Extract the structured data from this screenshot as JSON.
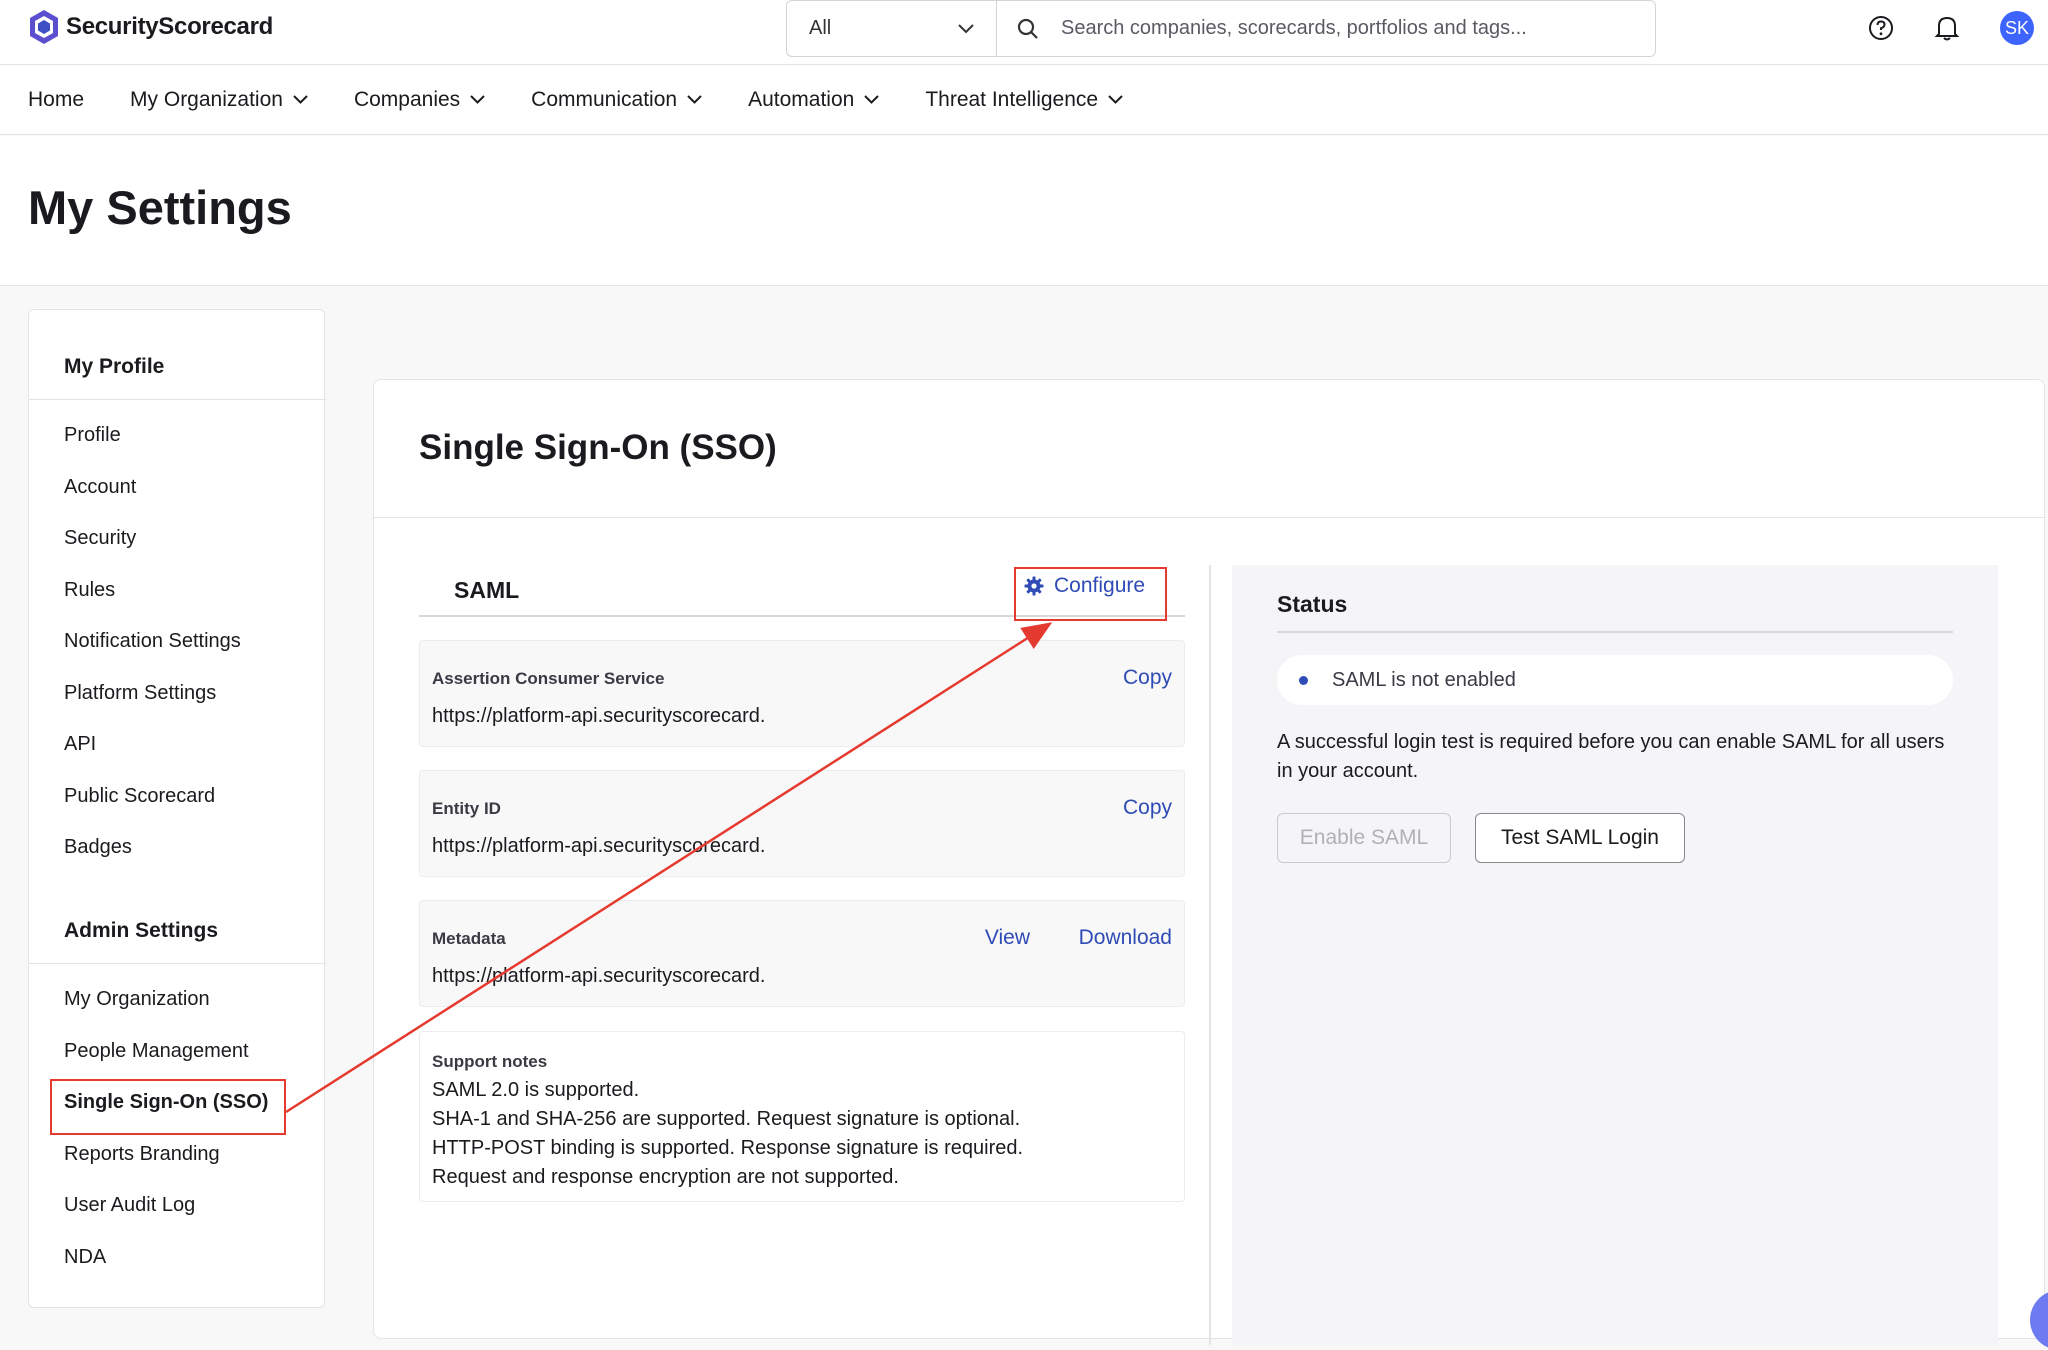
{
  "brand": {
    "name": "SecurityScorecard",
    "accent": "#3e4fc4"
  },
  "search": {
    "scope_value": "All",
    "placeholder": "Search companies, scorecards, portfolios and tags..."
  },
  "header_icons": {
    "help": "help-icon",
    "notifications": "bell-icon",
    "avatar_initials": "SK"
  },
  "nav": [
    {
      "label": "Home"
    },
    {
      "label": "My Organization",
      "dropdown": true
    },
    {
      "label": "Companies",
      "dropdown": true
    },
    {
      "label": "Communication",
      "dropdown": true
    },
    {
      "label": "Automation",
      "dropdown": true
    },
    {
      "label": "Threat Intelligence",
      "dropdown": true
    }
  ],
  "page": {
    "title": "My Settings"
  },
  "sidebar": {
    "profile_heading": "My Profile",
    "profile_items": [
      "Profile",
      "Account",
      "Security",
      "Rules",
      "Notification Settings",
      "Platform Settings",
      "API",
      "Public Scorecard",
      "Badges"
    ],
    "admin_heading": "Admin Settings",
    "admin_items": [
      "My Organization",
      "People Management",
      "Single Sign-On (SSO)",
      "Reports Branding",
      "User Audit Log",
      "NDA"
    ],
    "active_item": "Single Sign-On (SSO)"
  },
  "sso": {
    "title": "Single Sign-On (SSO)",
    "saml_heading": "SAML",
    "configure_label": "Configure",
    "fields": [
      {
        "label": "Assertion Consumer Service",
        "value": "https://platform-api.securityscorecard.",
        "actions": [
          "Copy"
        ]
      },
      {
        "label": "Entity ID",
        "value": "https://platform-api.securityscorecard.",
        "actions": [
          "Copy"
        ]
      },
      {
        "label": "Metadata",
        "value": "https://platform-api.securityscorecard.",
        "actions": [
          "View",
          "Download"
        ]
      }
    ],
    "support_notes": {
      "label": "Support notes",
      "lines": [
        "SAML 2.0 is supported.",
        "SHA-1 and SHA-256 are supported. Request signature is optional.",
        "HTTP-POST binding is supported. Response signature is required.",
        "Request and response encryption are not supported."
      ]
    },
    "status": {
      "heading": "Status",
      "state": "SAML is not enabled",
      "description": "A successful login test is required before you can enable SAML for all users in your account.",
      "enable_label": "Enable SAML",
      "test_label": "Test SAML Login"
    }
  },
  "annotation_color": "#e53a2f"
}
